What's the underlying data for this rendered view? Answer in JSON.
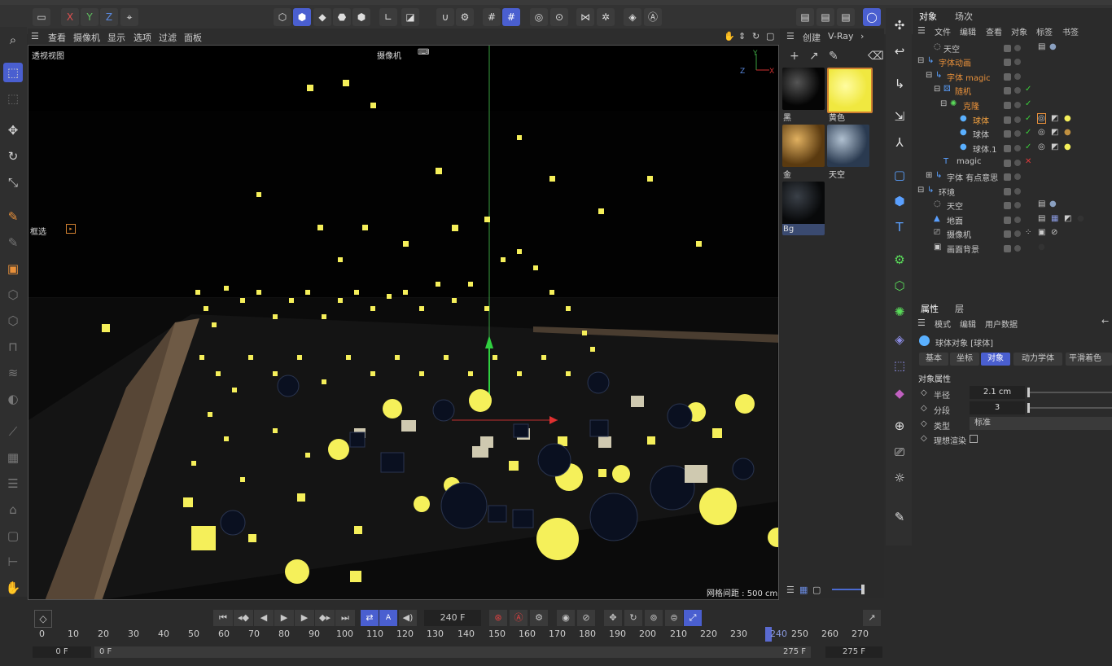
{
  "viewport": {
    "menu": [
      "查看",
      "摄像机",
      "显示",
      "选项",
      "过滤",
      "面板"
    ],
    "label": "透视视图",
    "camera": "摄像机",
    "grid_info": "网格间距 : 500 cm",
    "select_label": "框选"
  },
  "topbar": {
    "axes": [
      "X",
      "Y",
      "Z"
    ]
  },
  "materials": {
    "menu": [
      "创建",
      "V-Ray"
    ],
    "items": [
      {
        "name": "黑",
        "color": "#111111"
      },
      {
        "name": "黄色",
        "color": "#f5f05a"
      },
      {
        "name": "金",
        "color": "#8a6a2a"
      },
      {
        "name": "天空",
        "color": "#4a5a70"
      },
      {
        "name": "Bg",
        "color": "#202428"
      }
    ]
  },
  "objects": {
    "tabs": [
      "对象",
      "场次"
    ],
    "menu": [
      "文件",
      "编辑",
      "查看",
      "对象",
      "标签",
      "书签"
    ],
    "rows": [
      {
        "name": "天空",
        "indent": 0,
        "color": "#cfcfcf"
      },
      {
        "name": "字体动画",
        "indent": 1,
        "color": "#e8903a"
      },
      {
        "name": "字体 magic",
        "indent": 2,
        "color": "#e8903a"
      },
      {
        "name": "随机",
        "indent": 3,
        "color": "#e8903a"
      },
      {
        "name": "克隆",
        "indent": 3,
        "color": "#e8903a"
      },
      {
        "name": "球体",
        "indent": 4,
        "color": "#f0a040"
      },
      {
        "name": "球体",
        "indent": 4,
        "color": "#cfcfcf"
      },
      {
        "name": "球体.1",
        "indent": 4,
        "color": "#cfcfcf"
      },
      {
        "name": "magic",
        "indent": 3,
        "color": "#cfcfcf"
      },
      {
        "name": "字体 有点意思",
        "indent": 2,
        "color": "#cfcfcf"
      },
      {
        "name": "环境",
        "indent": 1,
        "color": "#cfcfcf"
      },
      {
        "name": "天空",
        "indent": 2,
        "color": "#cfcfcf"
      },
      {
        "name": "地面",
        "indent": 2,
        "color": "#cfcfcf"
      },
      {
        "name": "摄像机",
        "indent": 2,
        "color": "#cfcfcf"
      },
      {
        "name": "画面背景",
        "indent": 2,
        "color": "#cfcfcf"
      }
    ]
  },
  "attributes": {
    "tabs": [
      "属性",
      "层"
    ],
    "menu": [
      "模式",
      "编辑",
      "用户数据"
    ],
    "object_title": "球体对象 [球体]",
    "sub_tabs": [
      "基本",
      "坐标",
      "对象",
      "动力学体",
      "平滑着色"
    ],
    "section": "对象属性",
    "fields": [
      {
        "label": "半径",
        "value": "2.1 cm"
      },
      {
        "label": "分段",
        "value": "3"
      },
      {
        "label": "类型",
        "value": "标准"
      },
      {
        "label": "理想渲染",
        "value": ""
      }
    ]
  },
  "timeline": {
    "current_frame": "240 F",
    "ticks": [
      "0",
      "10",
      "20",
      "30",
      "40",
      "50",
      "60",
      "70",
      "80",
      "90",
      "100",
      "110",
      "120",
      "130",
      "140",
      "150",
      "160",
      "170",
      "180",
      "190",
      "200",
      "210",
      "220",
      "230",
      "240",
      "250",
      "260",
      "270"
    ],
    "playhead": "240",
    "start": "0 F",
    "start2": "0 F",
    "end": "275 F",
    "end2": "275 F"
  }
}
